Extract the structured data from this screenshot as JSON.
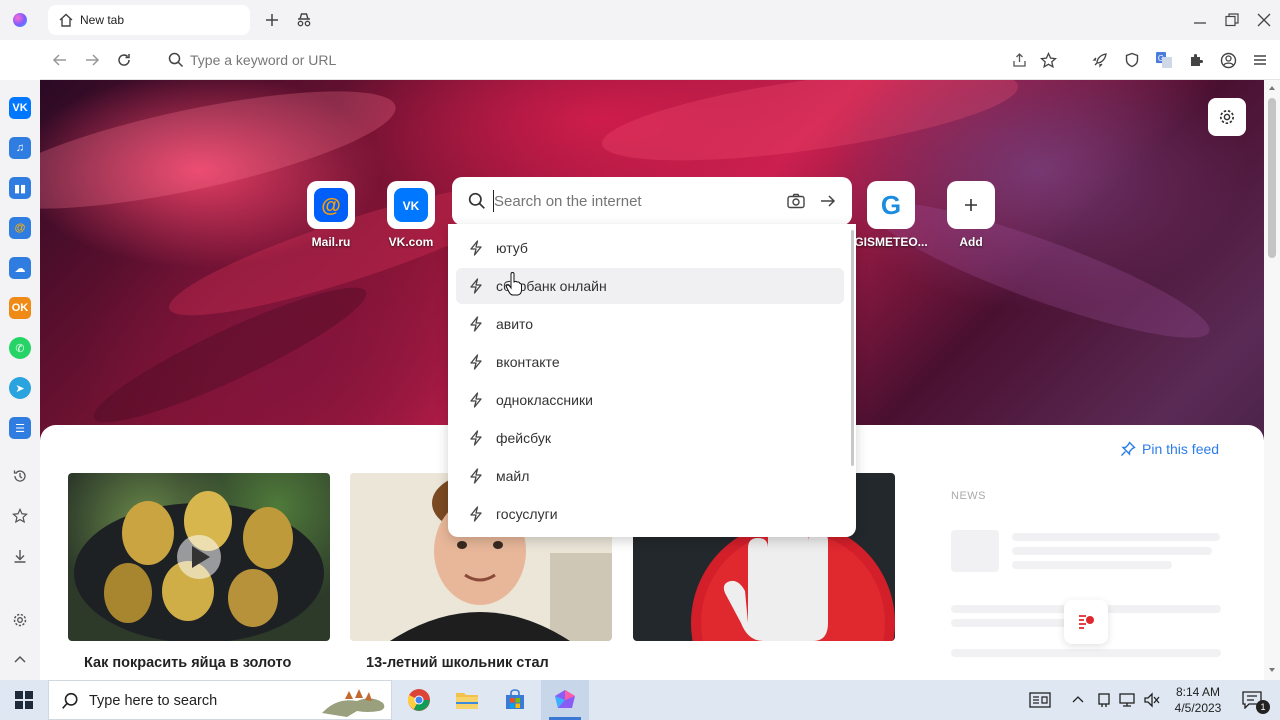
{
  "browser": {
    "tab_title": "New tab",
    "address_placeholder": "Type a keyword or URL"
  },
  "search": {
    "placeholder": "Search on the internet",
    "suggestions": [
      "ютуб",
      "сбербанк онлайн",
      "авито",
      "вконтакте",
      "одноклассники",
      "фейсбук",
      "майл",
      "госуслуги"
    ],
    "hovered_index": 1
  },
  "tiles": [
    {
      "label": "Mail.ru",
      "icon": "mailru-icon"
    },
    {
      "label": "VK.com",
      "icon": "vk-icon"
    },
    {
      "label": "GISMETEO...",
      "icon": "gismeteo-icon"
    },
    {
      "label": "Add",
      "icon": "plus-icon"
    }
  ],
  "feed": {
    "pin_label": "Pin this feed",
    "news_label": "NEWS",
    "cards": [
      {
        "title": "Как покрасить яйца в золото"
      },
      {
        "title": "13-летний школьник стал"
      }
    ]
  },
  "taskbar": {
    "search_placeholder": "Type here to search",
    "time": "8:14 AM",
    "date": "4/5/2023",
    "notification_count": "1"
  },
  "colors": {
    "accent": "#2b7de9",
    "vk": "#0077ff",
    "mailru": "#005ff9"
  }
}
